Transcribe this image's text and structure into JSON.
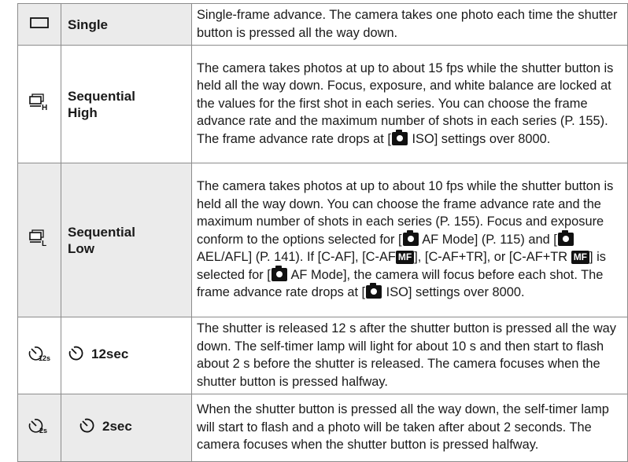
{
  "rows": [
    {
      "icon": "single-frame-icon",
      "name": "Single",
      "desc": "Single-frame advance. The camera takes one photo each time the shutter button is pressed all the way down."
    },
    {
      "icon": "sequential-high-icon",
      "name": "Sequential High",
      "desc": "The camera takes photos at up to about 15 fps while the shutter button is held all the way down. Focus, exposure, and white balance are locked at the values for the first shot in each series. You can choose the frame advance rate and the maximum number of shots in each series (P. 155). The frame advance rate drops at [",
      "desc_tail": " ISO] settings over 8000."
    },
    {
      "icon": "sequential-low-icon",
      "name": "Sequential Low",
      "desc_parts": [
        "The camera takes photos at up to about 10 fps while the shutter button is held all the way down. You can choose the frame advance rate and the maximum number of shots in each series (P. 155). Focus and exposure conform to the options selected for [",
        " AF Mode] (P. 115) and [",
        " AEL/AFL] (P. 141). If [C-AF], [C-AF",
        "], [C-AF+TR], or [C-AF+TR ",
        "] is selected for [",
        " AF Mode], the camera will focus before each shot. The frame advance rate drops at [",
        " ISO] settings over 8000."
      ],
      "mf_label": "MF"
    },
    {
      "icon": "self-timer-12s-icon",
      "name": "12sec",
      "icon_sub": "12s",
      "desc": "The shutter is released 12 s after the shutter button is pressed all the way down. The self-timer lamp will light for about 10 s and then start to flash about 2 s before the shutter is released. The camera focuses when the shutter button is pressed halfway."
    },
    {
      "icon": "self-timer-2s-icon",
      "name": "2sec",
      "icon_sub": "2s",
      "desc": "When the shutter button is pressed all the way down, the self-timer lamp will start to flash and a photo will be taken after about 2 seconds. The camera focuses when the shutter button is pressed halfway."
    }
  ]
}
